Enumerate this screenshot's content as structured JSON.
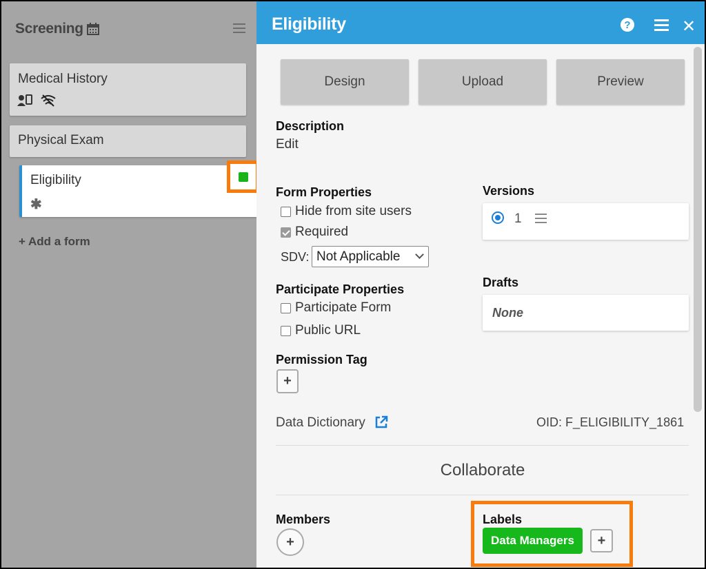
{
  "sidebar": {
    "title": "Screening",
    "forms": [
      {
        "label": "Medical History"
      },
      {
        "label": "Physical Exam"
      },
      {
        "label": "Eligibility",
        "marker": "✱"
      }
    ],
    "status_color": "#1ab31a",
    "add_form_label": "+ Add a form"
  },
  "header": {
    "title": "Eligibility",
    "help_icon": "?",
    "menu_icon": "hamburger",
    "close_icon": "✕"
  },
  "tabs": [
    {
      "label": "Design"
    },
    {
      "label": "Upload"
    },
    {
      "label": "Preview"
    }
  ],
  "description": {
    "heading": "Description",
    "edit_label": "Edit"
  },
  "form_properties": {
    "heading": "Form Properties",
    "hide_label": "Hide from site users",
    "hide_checked": false,
    "required_label": "Required",
    "required_checked": true,
    "sdv_label": "SDV:",
    "sdv_value": "Not Applicable"
  },
  "participate_properties": {
    "heading": "Participate Properties",
    "participate_form_label": "Participate Form",
    "public_url_label": "Public URL"
  },
  "permission_tag": {
    "heading": "Permission Tag",
    "add": "+"
  },
  "versions": {
    "heading": "Versions",
    "items": [
      {
        "number": "1",
        "selected": true
      }
    ]
  },
  "drafts": {
    "heading": "Drafts",
    "empty": "None"
  },
  "data_dictionary": {
    "label": "Data Dictionary",
    "oid": "OID: F_ELIGIBILITY_1861"
  },
  "collaborate": {
    "heading": "Collaborate"
  },
  "members": {
    "heading": "Members",
    "add": "+"
  },
  "labels": {
    "heading": "Labels",
    "items": [
      "Data Managers"
    ],
    "add": "+",
    "tag_color": "#16b81c",
    "highlight_color": "#f77b0d"
  }
}
